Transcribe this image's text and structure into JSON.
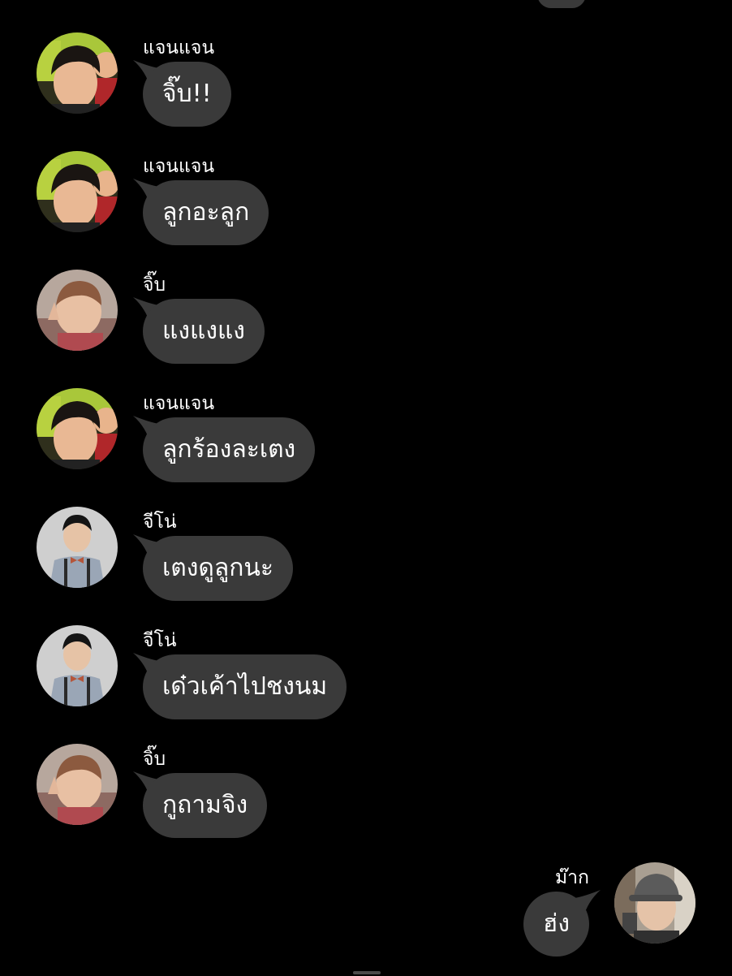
{
  "chat": {
    "messages": [
      {
        "sender": "แจนแจน",
        "text": "จิ๊บ!!",
        "avatar": "boy-avatar-green-background"
      },
      {
        "sender": "แจนแจน",
        "text": "ลูกอะลูก",
        "avatar": "boy-avatar-green-background"
      },
      {
        "sender": "จิ๊บ",
        "text": "แงแงแง",
        "avatar": "child-peace-sign-avatar"
      },
      {
        "sender": "แจนแจน",
        "text": "ลูกร้องละเตง",
        "avatar": "boy-avatar-green-background"
      },
      {
        "sender": "จีโน่",
        "text": "เตงดูลูกนะ",
        "avatar": "boy-suspenders-avatar"
      },
      {
        "sender": "จีโน่",
        "text": "เด๋วเค้าไปชงนม",
        "avatar": "boy-suspenders-avatar"
      },
      {
        "sender": "จิ๊บ",
        "text": "กูถามจิง",
        "avatar": "child-peace-sign-avatar"
      },
      {
        "sender": "ม๊าก",
        "text": "ฮ่ง",
        "avatar": "boy-gray-hat-avatar"
      }
    ]
  },
  "colors": {
    "background": "#000000",
    "bubble": "#3a3a3a",
    "text": "#ffffff"
  }
}
